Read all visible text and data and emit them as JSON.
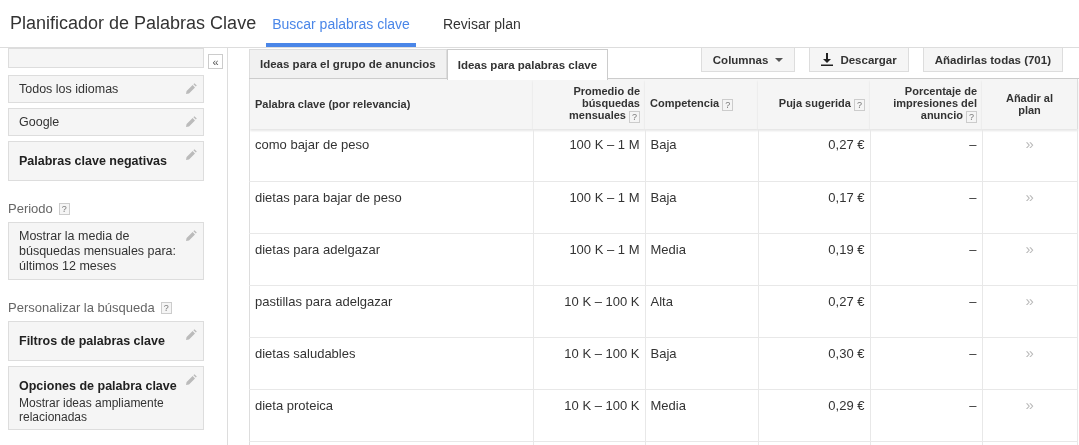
{
  "header": {
    "title": "Planificador de Palabras Clave",
    "nav": [
      {
        "label": "Buscar palabras clave",
        "selected": true
      },
      {
        "label": "Revisar plan",
        "selected": false
      }
    ]
  },
  "sidebar": {
    "collapse": "«",
    "top_cards": [
      {
        "kind": "plain",
        "title": "Todos los idiomas"
      },
      {
        "kind": "plain",
        "title": "Google"
      },
      {
        "kind": "bold",
        "title": "Palabras clave negativas"
      }
    ],
    "sections": [
      {
        "title": "Periodo",
        "help": "?",
        "cards": [
          {
            "kind": "plain",
            "title": "Mostrar la media de búsquedas mensuales para: últimos 12 meses"
          }
        ]
      },
      {
        "title": "Personalizar la búsqueda",
        "help": "?",
        "cards": [
          {
            "kind": "bold",
            "title": "Filtros de palabras clave"
          },
          {
            "kind": "bold",
            "title": "Opciones de palabra clave",
            "description": "Mostrar ideas ampliamente relacionadas"
          }
        ]
      }
    ]
  },
  "tabs": [
    {
      "label": "Ideas para el grupo de anuncios",
      "selected": false
    },
    {
      "label": "Ideas para palabras clave",
      "selected": true
    }
  ],
  "toolbar": {
    "columns": "Columnas",
    "download": "Descargar",
    "add_all": "Añadirlas todas (701)"
  },
  "table": {
    "columns": [
      {
        "label": "Palabra clave (por relevancia)"
      },
      {
        "label": "Promedio de búsquedas mensuales",
        "help": "?"
      },
      {
        "label": "Competencia",
        "help": "?"
      },
      {
        "label": "Puja sugerida",
        "help": "?"
      },
      {
        "label": "Porcentaje de impresiones del anuncio",
        "help": "?"
      },
      {
        "label": "Añadir al plan"
      }
    ],
    "rows": [
      {
        "keyword": "como bajar de peso",
        "searches": "100 K – 1 M",
        "competition": "Baja",
        "bid": "0,27 €",
        "impressions": "–",
        "add": "»"
      },
      {
        "keyword": "dietas para bajar de peso",
        "searches": "100 K – 1 M",
        "competition": "Baja",
        "bid": "0,17 €",
        "impressions": "–",
        "add": "»"
      },
      {
        "keyword": "dietas para adelgazar",
        "searches": "100 K – 1 M",
        "competition": "Media",
        "bid": "0,19 €",
        "impressions": "–",
        "add": "»"
      },
      {
        "keyword": "pastillas para adelgazar",
        "searches": "10 K – 100 K",
        "competition": "Alta",
        "bid": "0,27 €",
        "impressions": "–",
        "add": "»"
      },
      {
        "keyword": "dietas saludables",
        "searches": "10 K – 100 K",
        "competition": "Baja",
        "bid": "0,30 €",
        "impressions": "–",
        "add": "»"
      },
      {
        "keyword": "dieta proteica",
        "searches": "10 K – 100 K",
        "competition": "Media",
        "bid": "0,29 €",
        "impressions": "–",
        "add": "»"
      }
    ]
  }
}
